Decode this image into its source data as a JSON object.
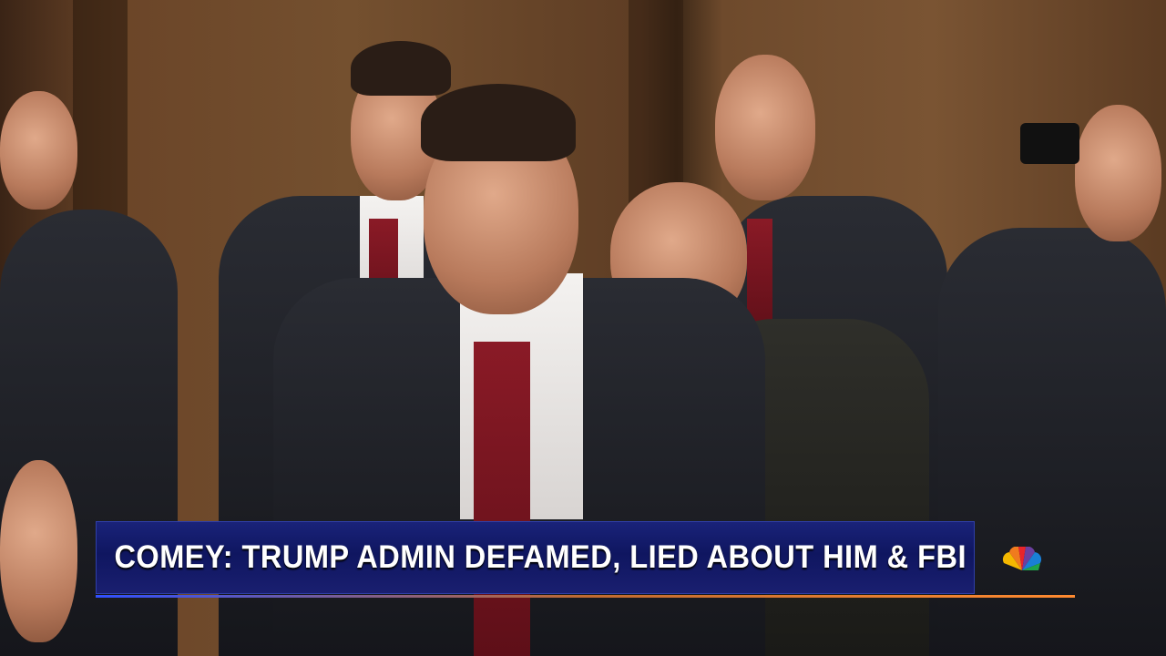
{
  "lower_third": {
    "headline": "COMEY: TRUMP ADMIN DEFAMED, LIED ABOUT HIM & FBI"
  },
  "network_logo": {
    "icon": "nbc-peacock-icon",
    "colors": [
      "#f5b800",
      "#e8242b",
      "#6b3fa0",
      "#1a7fd6",
      "#1fa34a",
      "#f07b1e"
    ]
  },
  "colors": {
    "banner": "#121a66",
    "text": "#ffffff"
  }
}
